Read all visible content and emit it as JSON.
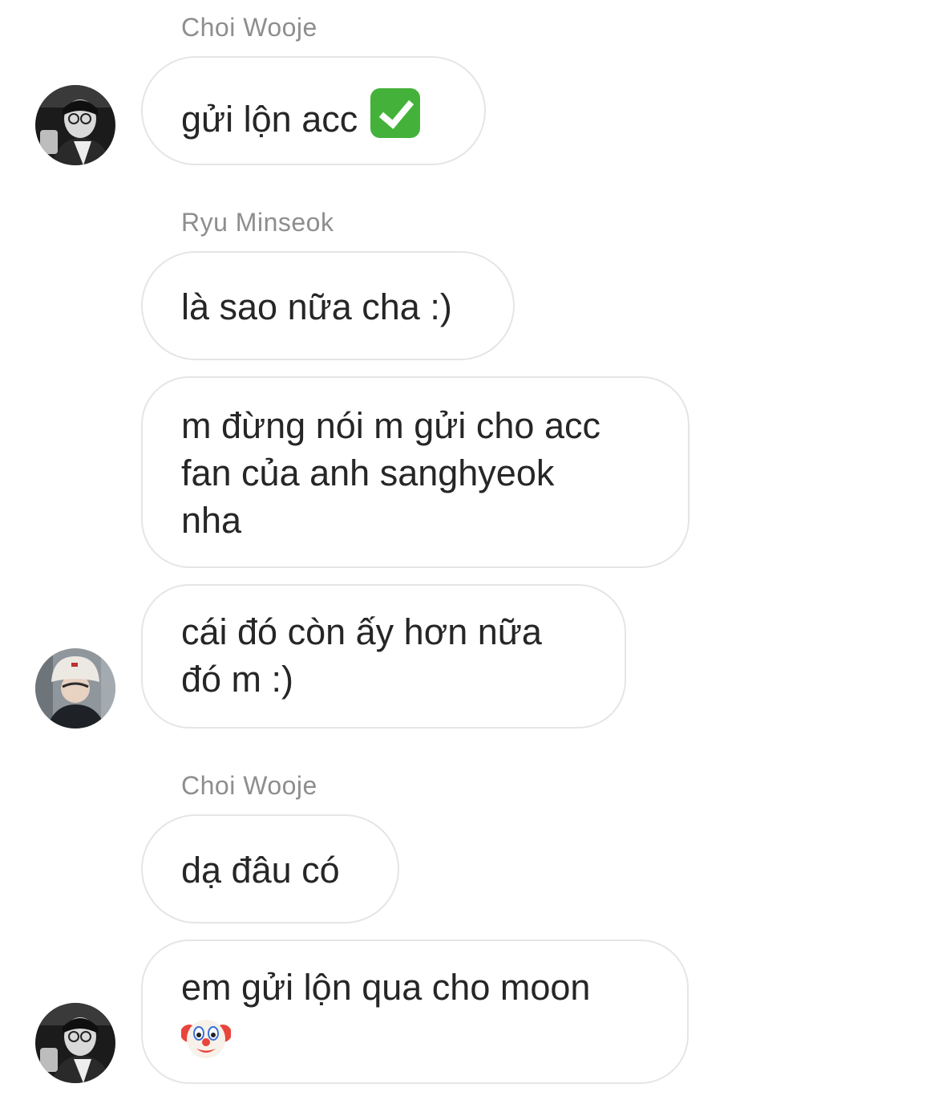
{
  "conversation": {
    "messages": [
      {
        "sender": "Choi Wooje",
        "lines": [
          "gửi lộn acc"
        ],
        "emoji": "white-heavy-check-mark"
      },
      {
        "sender": "Ryu Minseok",
        "lines": [
          "là sao nữa cha :)"
        ]
      },
      {
        "lines": [
          "m đừng nói m gửi cho acc",
          "fan của anh sanghyeok",
          "nha"
        ]
      },
      {
        "lines": [
          "cái đó còn ấy hơn nữa",
          "đó m :)"
        ]
      },
      {
        "sender": "Choi Wooje",
        "lines": [
          "dạ đâu có"
        ]
      },
      {
        "lines": [
          "em gửi lộn qua cho moon"
        ],
        "emoji": "clown-face"
      }
    ]
  },
  "colors": {
    "bubble_border": "#e5e5e5",
    "sender_name": "#8e8e8e",
    "message_text": "#262626",
    "check_emoji": "#44b23a"
  }
}
